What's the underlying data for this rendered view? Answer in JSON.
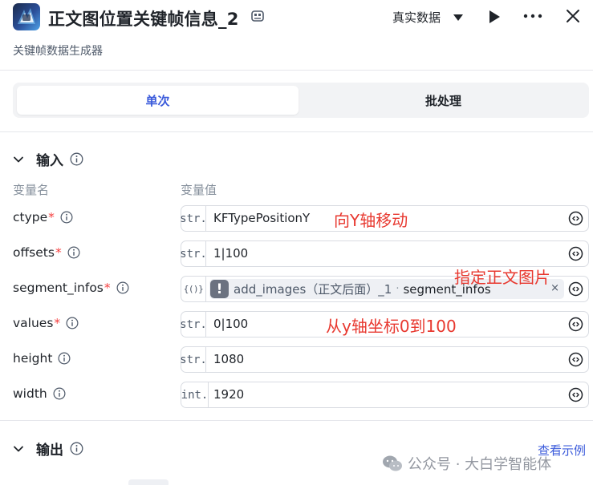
{
  "header": {
    "title": "正文图位置关键帧信息_2",
    "data_mode": "真实数据",
    "app_icon": "app-logo-icon",
    "title_icon": "template-icon",
    "run_icon": "play-icon",
    "more_icon": "more-icon",
    "close_icon": "close-icon"
  },
  "subtitle": "关键帧数据生成器",
  "tabs": [
    {
      "label": "单次",
      "active": true
    },
    {
      "label": "批处理",
      "active": false
    }
  ],
  "input_section": {
    "title": "输入",
    "col_name": "变量名",
    "col_value": "变量值",
    "params": [
      {
        "name": "ctype",
        "required": true,
        "type": "str.",
        "value": "KFTypePositionY"
      },
      {
        "name": "offsets",
        "required": true,
        "type": "str.",
        "value": "1|100"
      },
      {
        "name": "segment_infos",
        "required": true,
        "type": "{()}",
        "ref_node": "add_images（正文后面）_1",
        "ref_sep": "·",
        "ref_field": "segment_infos",
        "ref_remove": "×"
      },
      {
        "name": "values",
        "required": true,
        "type": "str.",
        "value": "0|100"
      },
      {
        "name": "height",
        "required": false,
        "type": "str.",
        "value": "1080"
      },
      {
        "name": "width",
        "required": false,
        "type": "int.",
        "value": "1920"
      }
    ]
  },
  "annotations": {
    "ctype": "向Y轴移动",
    "segment_infos": "指定正文图片",
    "values": "从y轴坐标0到100"
  },
  "output_section": {
    "title": "输出",
    "example_link": "查看示例"
  },
  "watermark": "公众号 · 大白学智能体",
  "colors": {
    "accent": "#3b5bdb",
    "required": "#f53f3f",
    "annotation": "#e8382f"
  }
}
